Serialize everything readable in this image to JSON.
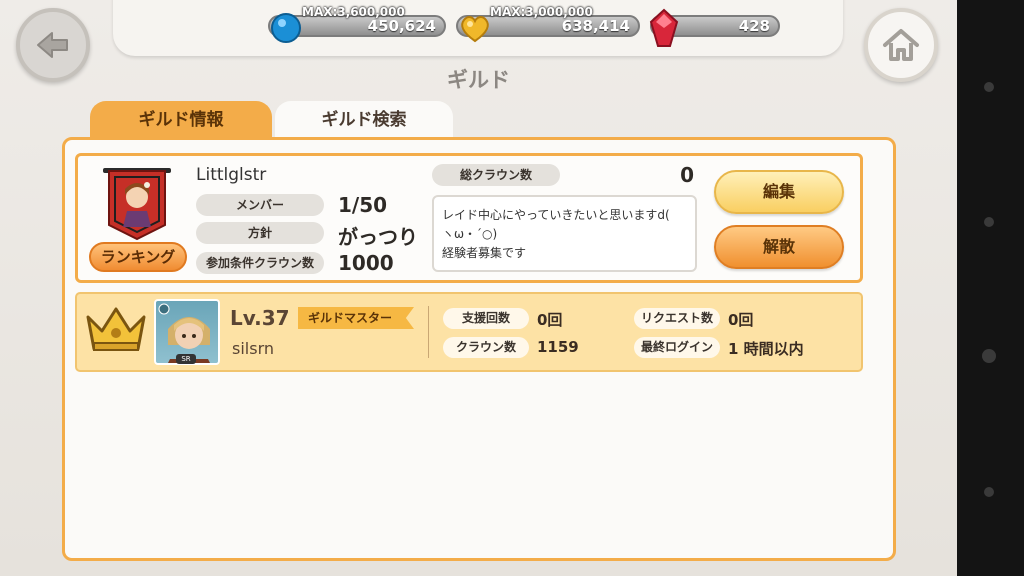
{
  "hud": {
    "blue": {
      "max": "MAX:3,600,000",
      "value": "450,624",
      "icon": "blue-orb-icon"
    },
    "gold": {
      "max": "MAX:3,000,000",
      "value": "638,414",
      "icon": "gold-heart-icon"
    },
    "gem": {
      "value": "428",
      "icon": "red-gem-icon"
    }
  },
  "page": {
    "title": "ギルド"
  },
  "tabs": [
    {
      "label": "ギルド情報",
      "active": true
    },
    {
      "label": "ギルド検索",
      "active": false
    }
  ],
  "guild": {
    "name": "Littlglstr",
    "ranking_label": "ランキング",
    "rows": [
      {
        "label": "メンバー",
        "value": "1/50"
      },
      {
        "label": "方針",
        "value": "がっつり"
      },
      {
        "label": "参加条件クラウン数",
        "value": "1000"
      }
    ],
    "crown_label": "総クラウン数",
    "crown_value": "0",
    "description_line1": "レイド中心にやっていきたいと思いますd(",
    "description_line2": "ヽω・´○)",
    "description_line3": "経験者募集です",
    "edit_label": "編集",
    "disband_label": "解散"
  },
  "member": {
    "level": "Lv.37",
    "role": "ギルドマスター",
    "name": "silsrn",
    "rarity": "SR",
    "stats": [
      {
        "label": "支援回数",
        "value": "0回"
      },
      {
        "label": "リクエスト数",
        "value": "0回"
      },
      {
        "label": "クラウン数",
        "value": "1159"
      },
      {
        "label": "最終ログイン",
        "value": "1 時間以内"
      }
    ]
  }
}
